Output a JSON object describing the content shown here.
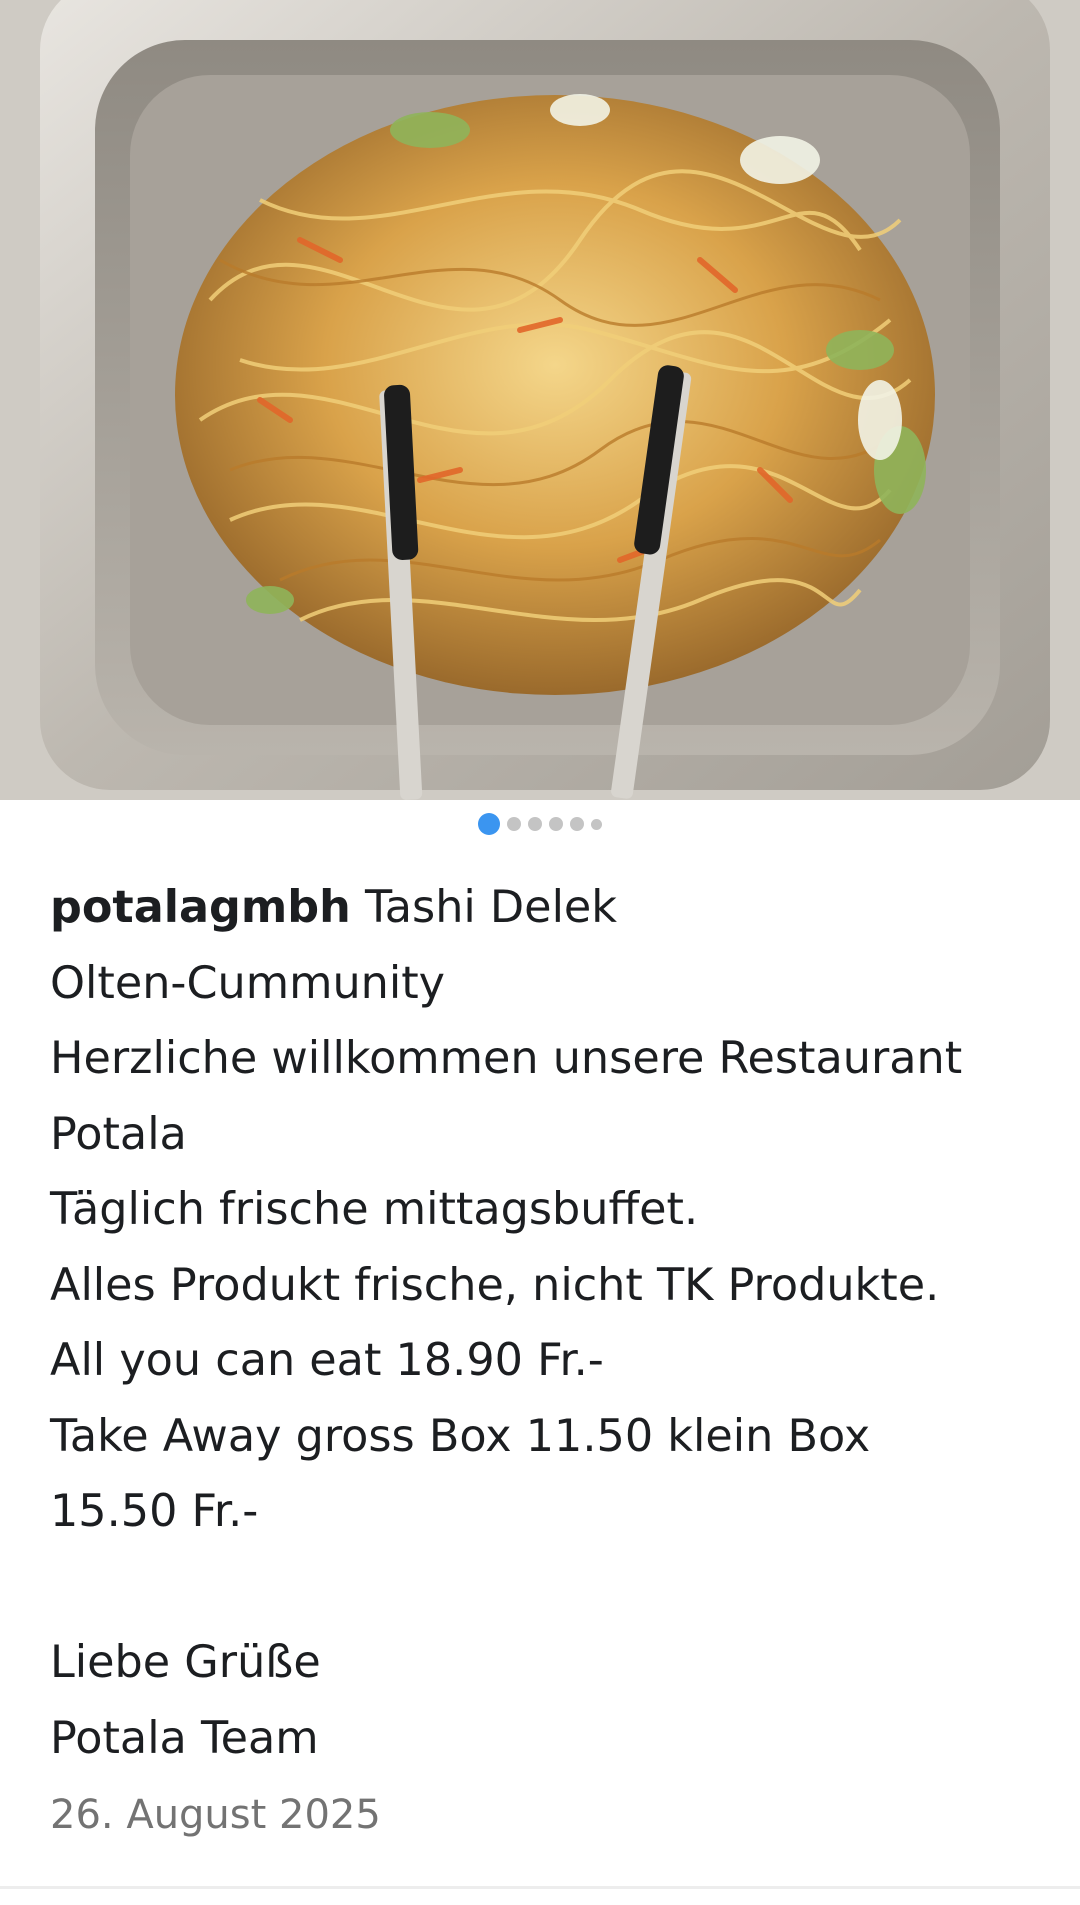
{
  "post": {
    "image_alt": "Fried noodles with vegetables in a stainless steel buffet tray with tongs",
    "carousel": {
      "total": 6,
      "active_index": 1
    },
    "username": "potalagmbh",
    "caption_first": "Tashi Delek",
    "caption_lines": [
      "Olten-Cummunity",
      "Herzliche willkommen unsere Restaurant",
      "Potala",
      "Täglich frische mittagsbuffet.",
      "Alles Produkt frische, nicht TK Produkte.",
      "All you can eat 18.90 Fr.-",
      "Take Away gross Box 11.50 klein Box",
      "15.50 Fr.-",
      "",
      "Liebe Grüße",
      "Potala Team"
    ],
    "date": "26. August 2025"
  },
  "colors": {
    "dot_active": "#3b95f0",
    "dot_inactive": "#c4c4c4",
    "date_text": "#737373"
  }
}
